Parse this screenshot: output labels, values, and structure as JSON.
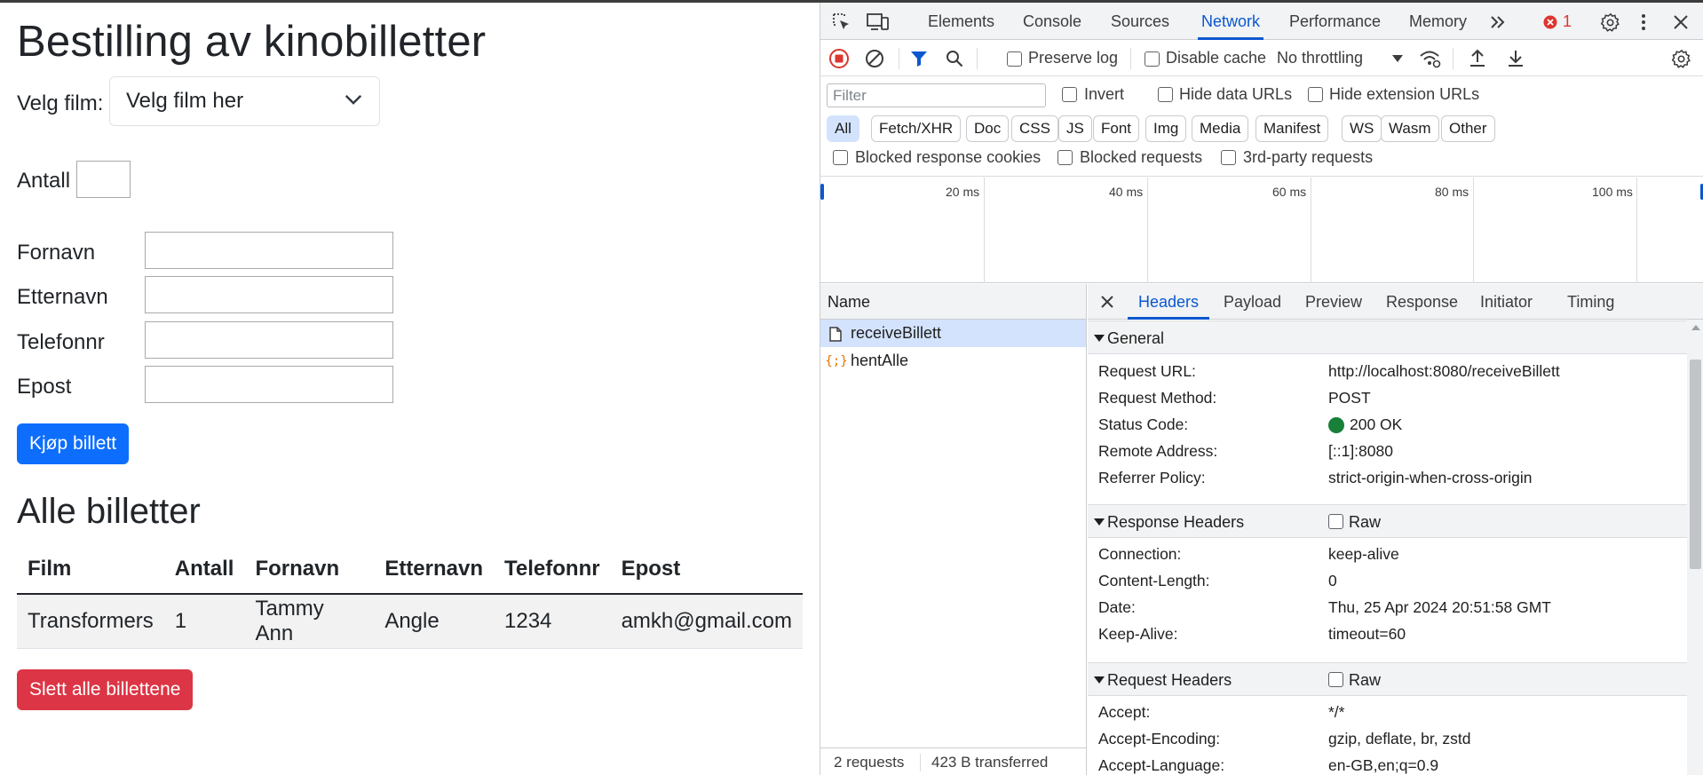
{
  "page": {
    "title": "Bestilling av kinobilletter",
    "film_label": "Velg film:",
    "film_select_value": "Velg film her",
    "antall_label": "Antall",
    "fornavn_label": "Fornavn",
    "etternavn_label": "Etternavn",
    "telefonnr_label": "Telefonnr",
    "epost_label": "Epost",
    "buy_button": "Kjøp billett",
    "list_title": "Alle billetter",
    "delete_button": "Slett alle billettene",
    "table": {
      "headers": [
        "Film",
        "Antall",
        "Fornavn",
        "Etternavn",
        "Telefonnr",
        "Epost"
      ],
      "rows": [
        [
          "Transformers",
          "1",
          "Tammy Ann",
          "Angle",
          "1234",
          "amkh@gmail.com"
        ]
      ]
    }
  },
  "devtools": {
    "tabs": [
      "Elements",
      "Console",
      "Sources",
      "Network",
      "Performance",
      "Memory"
    ],
    "active_tab": "Network",
    "error_count": "1",
    "toolbar": {
      "preserve_log": "Preserve log",
      "disable_cache": "Disable cache",
      "throttling": "No throttling"
    },
    "filter": {
      "placeholder": "Filter",
      "invert": "Invert",
      "hide_data_urls": "Hide data URLs",
      "hide_extension_urls": "Hide extension URLs",
      "chips": [
        "All",
        "Fetch/XHR",
        "Doc",
        "CSS",
        "JS",
        "Font",
        "Img",
        "Media",
        "Manifest",
        "WS",
        "Wasm",
        "Other"
      ],
      "blocked_response_cookies": "Blocked response cookies",
      "blocked_requests": "Blocked requests",
      "third_party": "3rd-party requests"
    },
    "timeline_ticks": [
      "20 ms",
      "40 ms",
      "60 ms",
      "80 ms",
      "100 ms"
    ],
    "names": {
      "header": "Name",
      "items": [
        "receiveBillett",
        "hentAlle"
      ],
      "footer_requests": "2 requests",
      "footer_transferred": "423 B transferred"
    },
    "detail": {
      "tabs": [
        "Headers",
        "Payload",
        "Preview",
        "Response",
        "Initiator",
        "Timing"
      ],
      "general_title": "General",
      "general": [
        [
          "Request URL:",
          "http://localhost:8080/receiveBillett"
        ],
        [
          "Request Method:",
          "POST"
        ],
        [
          "Status Code:",
          "200 OK"
        ],
        [
          "Remote Address:",
          "[::1]:8080"
        ],
        [
          "Referrer Policy:",
          "strict-origin-when-cross-origin"
        ]
      ],
      "status_color": "#188038",
      "response_headers_title": "Response Headers",
      "raw_label": "Raw",
      "response_headers": [
        [
          "Connection:",
          "keep-alive"
        ],
        [
          "Content-Length:",
          "0"
        ],
        [
          "Date:",
          "Thu, 25 Apr 2024 20:51:58 GMT"
        ],
        [
          "Keep-Alive:",
          "timeout=60"
        ]
      ],
      "request_headers_title": "Request Headers",
      "request_headers": [
        [
          "Accept:",
          "*/*"
        ],
        [
          "Accept-Encoding:",
          "gzip, deflate, br, zstd"
        ],
        [
          "Accept-Language:",
          "en-GB,en;q=0.9"
        ]
      ]
    }
  }
}
